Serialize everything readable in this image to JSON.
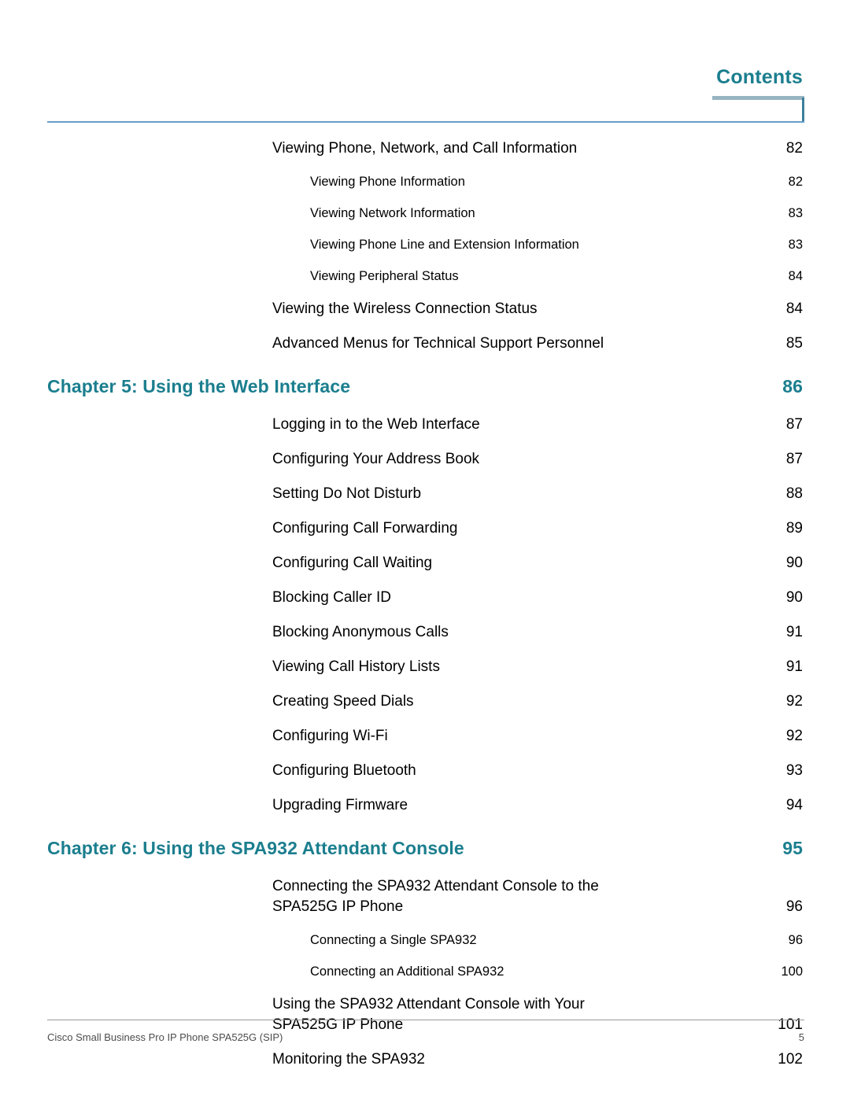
{
  "header": {
    "title": "Contents"
  },
  "colors": {
    "accent_teal": "#1b7e8e",
    "rule_thick": "#96b4c1",
    "rule_vertical": "#3c7f9b",
    "rule_long": "#6a9ec6",
    "footer_rule": "#9a9a9a",
    "body_text": "#000000",
    "footer_text": "#4d4d4d"
  },
  "toc": {
    "entries": [
      {
        "level": 1,
        "label": "Viewing Phone, Network, and Call Information",
        "page": "82"
      },
      {
        "level": 2,
        "label": "Viewing Phone Information",
        "page": "82"
      },
      {
        "level": 2,
        "label": "Viewing Network Information",
        "page": "83"
      },
      {
        "level": 2,
        "label": "Viewing Phone Line and Extension Information",
        "page": "83"
      },
      {
        "level": 2,
        "label": "Viewing Peripheral Status",
        "page": "84"
      },
      {
        "level": 1,
        "label": "Viewing the Wireless Connection Status",
        "page": "84"
      },
      {
        "level": 1,
        "label": "Advanced Menus for Technical Support Personnel",
        "page": "85"
      },
      {
        "level": 0,
        "label": "Chapter 5: Using the Web Interface",
        "page": "86"
      },
      {
        "level": 1,
        "label": "Logging in to the Web Interface",
        "page": "87"
      },
      {
        "level": 1,
        "label": "Configuring Your Address Book",
        "page": "87"
      },
      {
        "level": 1,
        "label": "Setting Do Not Disturb",
        "page": "88"
      },
      {
        "level": 1,
        "label": "Configuring Call Forwarding",
        "page": "89"
      },
      {
        "level": 1,
        "label": "Configuring Call Waiting",
        "page": "90"
      },
      {
        "level": 1,
        "label": "Blocking Caller ID",
        "page": "90"
      },
      {
        "level": 1,
        "label": "Blocking Anonymous Calls",
        "page": "91"
      },
      {
        "level": 1,
        "label": "Viewing Call History Lists",
        "page": "91"
      },
      {
        "level": 1,
        "label": "Creating Speed Dials",
        "page": "92"
      },
      {
        "level": 1,
        "label": "Configuring Wi-Fi",
        "page": "92"
      },
      {
        "level": 1,
        "label": "Configuring Bluetooth",
        "page": "93"
      },
      {
        "level": 1,
        "label": "Upgrading Firmware",
        "page": "94"
      },
      {
        "level": 0,
        "label": "Chapter 6: Using the SPA932 Attendant Console",
        "page": "95"
      },
      {
        "level": 1,
        "label": "Connecting the SPA932 Attendant Console to the\nSPA525G IP Phone",
        "page": "96",
        "wrapped": true
      },
      {
        "level": 2,
        "label": "Connecting a Single SPA932",
        "page": "96"
      },
      {
        "level": 2,
        "label": "Connecting an Additional SPA932",
        "page": "100"
      },
      {
        "level": 1,
        "label": "Using the SPA932 Attendant Console with Your\nSPA525G IP Phone",
        "page": "101",
        "wrapped": true
      },
      {
        "level": 1,
        "label": "Monitoring the SPA932",
        "page": "102"
      }
    ]
  },
  "footer": {
    "document_title": "Cisco Small Business Pro IP Phone SPA525G (SIP)",
    "page_number": "5"
  }
}
